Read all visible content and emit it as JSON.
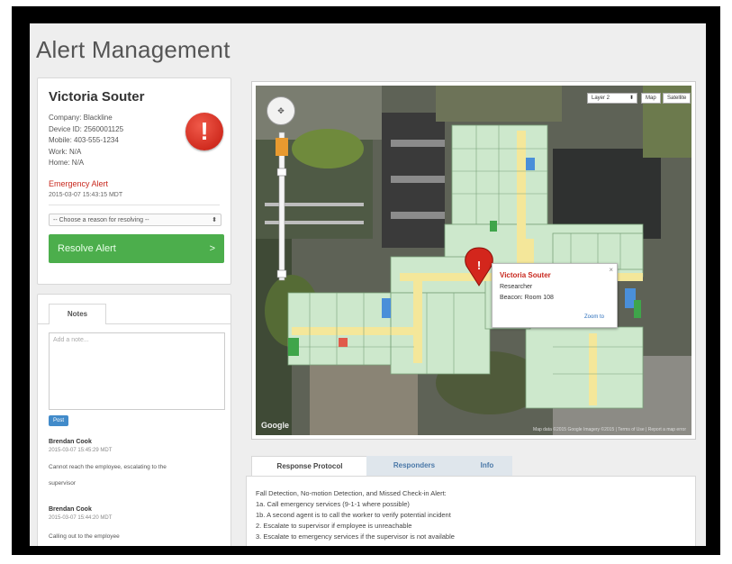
{
  "page": {
    "title": "Alert Management"
  },
  "person": {
    "name": "Victoria Souter",
    "company": "Company: Blackline",
    "device_id": "Device ID: 2560001125",
    "mobile": "Mobile: 403-555-1234",
    "work": "Work: N/A",
    "home": "Home: N/A",
    "emergency_title": "Emergency Alert",
    "emergency_time": "2015-03-07 15:43:15 MDT",
    "reason_placeholder": "-- Choose a reason for resolving --",
    "resolve_label": "Resolve Alert",
    "resolve_arrow": ">"
  },
  "notes": {
    "tab_label": "Notes",
    "placeholder": "Add a note...",
    "post_label": "Post",
    "entries": [
      {
        "author": "Brendan Cook",
        "time": "2015-03-07 15:45:29 MDT",
        "text": "Cannot reach the employee, escalating to the",
        "text2": "supervisor"
      },
      {
        "author": "Brendan Cook",
        "time": "2015-03-07 15:44:20 MDT",
        "text": "Calling out to the employee",
        "text2": ""
      }
    ]
  },
  "map": {
    "layer_select": "Layer 2",
    "map_btn": "Map",
    "sat_btn": "Satellite",
    "pan_glyph": "✥",
    "popup": {
      "name": "Victoria Souter",
      "role": "Researcher",
      "location": "Beacon: Room 108",
      "zoom": "Zoom to",
      "close": "×"
    },
    "google": "Google",
    "footer": "Map data ©2015 Google Imagery ©2015 | Terms of Use | Report a map error"
  },
  "tabs": [
    {
      "label": "Response Protocol"
    },
    {
      "label": "Responders"
    },
    {
      "label": "Info"
    }
  ],
  "protocol": {
    "lines": [
      "Fall Detection, No-motion Detection, and Missed Check-in Alert:",
      "1a. Call emergency services (9-1-1 where possible)",
      "1b. A second agent is to call the worker to verify potential incident",
      "2. Escalate to supervisor if employee is unreachable",
      "3. Escalate to emergency services if the supervisor is not available"
    ]
  },
  "colors": {
    "accent_red": "#c8281e",
    "resolve_green": "#4cae4c",
    "post_blue": "#428bca"
  }
}
